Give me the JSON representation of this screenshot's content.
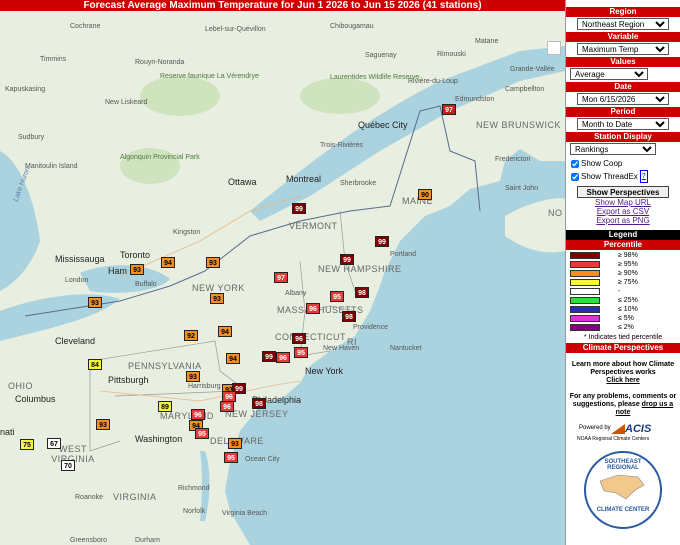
{
  "title": "Forecast Average Maximum Temperature for Jun 1 2026 to Jun 15 2026 (41 stations)",
  "panel": {
    "region_head": "Region",
    "region_value": "Northeast Region",
    "variable_head": "Variable",
    "variable_value": "Maximum Temp",
    "values_head": "Values",
    "values_value": "Average",
    "date_head": "Date",
    "date_value": "Mon 6/15/2026",
    "period_head": "Period",
    "period_value": "Month to Date",
    "display_head": "Station Display",
    "display_value": "Rankings",
    "show_coop": "Show Coop",
    "show_threadex": "Show ThreadEx",
    "threadex_help": "?",
    "perspectives_button": "Show Perspectives",
    "show_map_url": "Show Map URL",
    "export_csv": "Export as CSV",
    "export_png": "Export as PNG"
  },
  "legend": {
    "title": "Legend",
    "subtitle": "Percentile",
    "rows": [
      {
        "label": "≥ 98%",
        "color": "#800000"
      },
      {
        "label": "≥ 95%",
        "color": "#e83a3a"
      },
      {
        "label": "≥ 90%",
        "color": "#f5901e"
      },
      {
        "label": "≥ 75%",
        "color": "#f5f53a"
      },
      {
        "label": "-",
        "color": "#ffffff"
      },
      {
        "label": "≤ 25%",
        "color": "#33dd33"
      },
      {
        "label": "≤ 10%",
        "color": "#2a2acc"
      },
      {
        "label": "≤ 5%",
        "color": "#dd33dd"
      },
      {
        "label": "≤ 2%",
        "color": "#800080"
      }
    ],
    "note": "* Indicates tied percentile",
    "climate_head": "Climate Perspectives"
  },
  "info": {
    "learn": "Learn more about how Climate Perspectives works",
    "click": "Click here",
    "problems": "For any problems, comments or suggestions, please",
    "drop": "drop us a note"
  },
  "logos": {
    "acis_powered": "Powered by",
    "acis_name": "ACIS",
    "acis_sub": "NOAA Regional Climate Centers",
    "srcc_top": "SOUTHEAST REGIONAL",
    "srcc_bottom": "CLIMATE CENTER"
  },
  "map_labels": {
    "cochrane": "Cochrane",
    "lebel": "Lebel-sur-Quévillon",
    "chibougamau": "Chibougamau",
    "saguenay": "Saguenay",
    "rimouski": "Rimouski",
    "matane": "Matane",
    "grande_vallee": "Grande-Vallée",
    "timmins": "Timmins",
    "rouyn": "Rouyn-Noranda",
    "reserve": "Reserve faunique La Vérendrye",
    "laurentides": "Laurentides Wildlife Reserve",
    "riviere": "Rivière-du-Loup",
    "kapuskasing": "Kapuskasing",
    "new_liskeard": "New Liskeard",
    "edmundston": "Edmundston",
    "campbellton": "Campbellton",
    "quebec": "Québec City",
    "new_brunswick": "NEW BRUNSWICK",
    "sudbury": "Sudbury",
    "trois": "Trois-Rivières",
    "algonquin": "Algonquin Provincial Park",
    "manitoulin": "Manitoulin Island",
    "fredericton": "Fredericton",
    "ottawa": "Ottawa",
    "montreal": "Montreal",
    "sherbrooke": "Sherbrooke",
    "saint_john": "Saint John",
    "maine": "MAINE",
    "kingston": "Kingston",
    "vermont": "VERMONT",
    "portland": "Portland",
    "mississauga": "Mississauga",
    "toronto": "Toronto",
    "new_hampshire": "NEW HAMPSHIRE",
    "hamilton": "Ham",
    "london": "London",
    "buffalo": "Buffalo",
    "new_york": "NEW YORK",
    "albany": "Albany",
    "massachusetts": "MASSACHUSETTS",
    "providence": "Providence",
    "connecticut": "CONNECTICUT",
    "ri": "RI",
    "cleveland": "Cleveland",
    "new_haven": "New Haven",
    "nantucket": "Nantucket",
    "pennsylvania": "PENNSYLVANIA",
    "nyc": "New York",
    "ohio": "OHIO",
    "pittsburgh": "Pittsburgh",
    "harrisburg": "Harrisburg",
    "columbus": "Columbus",
    "philadelphia": "Philadelphia",
    "maryland": "MARYLAND",
    "new_jersey": "NEW JERSEY",
    "cincinnati": "nati",
    "washington": "Washington",
    "west_virginia": "WEST VIRGINIA",
    "delaware": "DELAWARE",
    "ocean_city": "Ocean City",
    "roanoke": "Roanoke",
    "richmond": "Richmond",
    "virginia": "VIRGINIA",
    "norfolk": "Norfolk",
    "virginia_beach": "Virginia Beach",
    "greensboro": "Greensboro",
    "durham": "Durham",
    "lake_huron": "Lake Huron",
    "no": "NO"
  },
  "stations": [
    {
      "v": "97",
      "c": "#c42020",
      "tc": "#fff"
    },
    {
      "v": "90",
      "c": "#f5901e",
      "tc": "#000"
    },
    {
      "v": "99",
      "c": "#800000",
      "tc": "#fff"
    },
    {
      "v": "99",
      "c": "#800000",
      "tc": "#fff"
    },
    {
      "v": "99",
      "c": "#800000",
      "tc": "#fff"
    },
    {
      "v": "97",
      "c": "#e83a3a",
      "tc": "#fff"
    },
    {
      "v": "96",
      "c": "#e83a3a",
      "tc": "#fff"
    },
    {
      "v": "95",
      "c": "#e83a3a",
      "tc": "#fff"
    },
    {
      "v": "98",
      "c": "#800000",
      "tc": "#fff"
    },
    {
      "v": "98",
      "c": "#800000",
      "tc": "#fff"
    },
    {
      "v": "96",
      "c": "#800000",
      "tc": "#fff"
    },
    {
      "v": "95",
      "c": "#e83a3a",
      "tc": "#fff"
    },
    {
      "v": "99",
      "c": "#800000",
      "tc": "#fff"
    },
    {
      "v": "96",
      "c": "#e83a3a",
      "tc": "#fff"
    },
    {
      "v": "93",
      "c": "#f5901e",
      "tc": "#000"
    },
    {
      "v": "94",
      "c": "#f5901e",
      "tc": "#000"
    },
    {
      "v": "93",
      "c": "#f5901e",
      "tc": "#000"
    },
    {
      "v": "93",
      "c": "#f5901e",
      "tc": "#000"
    },
    {
      "v": "93",
      "c": "#f5901e",
      "tc": "#000"
    },
    {
      "v": "93",
      "c": "#f5901e",
      "tc": "#000"
    },
    {
      "v": "92",
      "c": "#f5901e",
      "tc": "#000"
    },
    {
      "v": "94",
      "c": "#f5901e",
      "tc": "#000"
    },
    {
      "v": "94",
      "c": "#f5901e",
      "tc": "#000"
    },
    {
      "v": "84",
      "c": "#f5f53a",
      "tc": "#000"
    },
    {
      "v": "93",
      "c": "#f5901e",
      "tc": "#000"
    },
    {
      "v": "99",
      "c": "#800000",
      "tc": "#fff"
    },
    {
      "v": "96",
      "c": "#e83a3a",
      "tc": "#fff"
    },
    {
      "v": "98",
      "c": "#800000",
      "tc": "#fff"
    },
    {
      "v": "96",
      "c": "#e83a3a",
      "tc": "#fff"
    },
    {
      "v": "89",
      "c": "#f5f53a",
      "tc": "#000"
    },
    {
      "v": "96",
      "c": "#e83a3a",
      "tc": "#fff"
    },
    {
      "v": "94",
      "c": "#f5901e",
      "tc": "#000"
    },
    {
      "v": "95",
      "c": "#e83a3a",
      "tc": "#fff"
    },
    {
      "v": "93",
      "c": "#f5901e",
      "tc": "#000"
    },
    {
      "v": "95",
      "c": "#e83a3a",
      "tc": "#fff"
    },
    {
      "v": "93",
      "c": "#f5901e",
      "tc": "#000"
    },
    {
      "v": "75",
      "c": "#f5f53a",
      "tc": "#000"
    },
    {
      "v": "67",
      "c": "#ffffff",
      "tc": "#000"
    },
    {
      "v": "70",
      "c": "#ffffff",
      "tc": "#000"
    },
    {
      "v": "99",
      "c": "#800000",
      "tc": "#fff"
    },
    {
      "v": "96",
      "c": "#e83a3a",
      "tc": "#fff"
    }
  ]
}
